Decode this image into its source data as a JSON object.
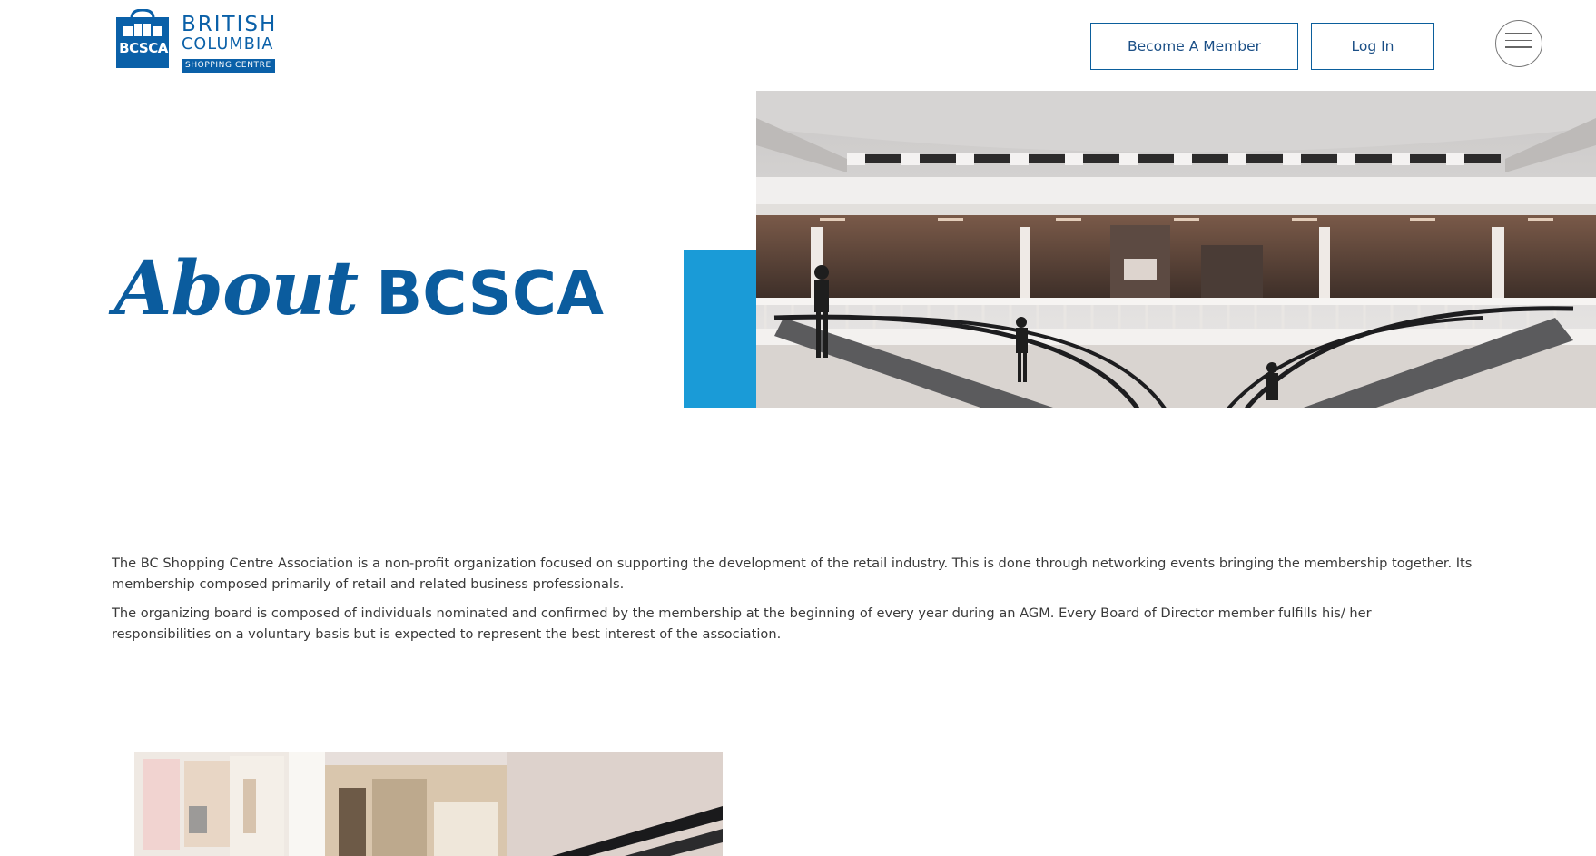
{
  "header": {
    "logo": {
      "acronym": "BCSCA",
      "line1": "BRITISH",
      "line2": "COLUMBIA",
      "line3": "SHOPPING CENTRE",
      "brand_color": "#0a60a8"
    },
    "buttons": {
      "member_label": "Become A Member",
      "login_label": "Log In"
    },
    "menu_icon": "hamburger-menu-icon"
  },
  "hero": {
    "title_script": "About",
    "title_plain": "BCSCA",
    "title_color": "#0b5c9e",
    "accent_color": "#1a9bd7",
    "image": "shopping-mall-escalators-photo"
  },
  "about": {
    "paragraphs": [
      "The BC Shopping Centre Association is a non-profit organization focused on supporting the development of the retail industry. This is done through networking events bringing the membership together. Its membership composed primarily of retail and related business professionals.",
      "The organizing board is composed of individuals nominated and confirmed by the membership at the beginning of every year during an AGM. Every Board of Director member fulfills his/ her responsibilities on a voluntary basis but is expected to represent the best interest of the association."
    ]
  },
  "lower_section": {
    "image": "mall-storefront-photo"
  }
}
